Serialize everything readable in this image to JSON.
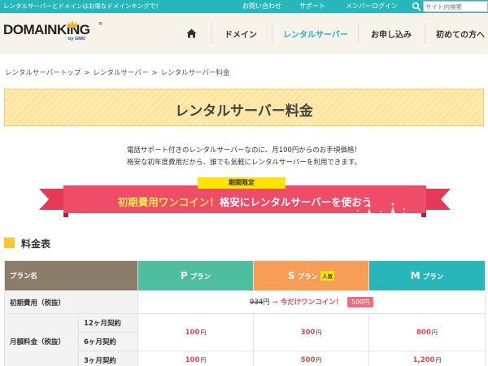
{
  "topbar": {
    "tagline": "レンタルサーバーとドメインはお得なドメインキングで！",
    "links": [
      "お問い合わせ",
      "サポート",
      "メンバーログイン"
    ],
    "search_placeholder": "サイト内検索"
  },
  "header": {
    "logo_main": "DOMAIN",
    "logo_accent": "KING",
    "logo_sub": "by GMO",
    "nav": [
      "ドメイン",
      "レンタルサーバー",
      "お申し込み",
      "初めての方へ"
    ],
    "active_nav": "レンタルサーバー"
  },
  "breadcrumb": [
    "レンタルサーバートップ",
    "レンタルサーバー",
    "レンタルサーバー料金"
  ],
  "page_title": "レンタルサーバー料金",
  "intro": [
    "電話サポート付きのレンタルサーバーなのに、月100円からのお手頃価格！",
    "格安な初年度費用だから、誰でも気軽にレンタルサーバーを利用できます。"
  ],
  "campaign": {
    "limited": "期間限定",
    "text_highlight": "初期費用ワンコイン！",
    "text_rest": "格安にレンタルサーバーを使おう"
  },
  "section_title": "料金表",
  "table": {
    "header_label": "プラン名",
    "plans": [
      {
        "letter": "P",
        "suffix": "プラン",
        "badge": ""
      },
      {
        "letter": "S",
        "suffix": "プラン",
        "badge": "人気"
      },
      {
        "letter": "M",
        "suffix": "プラン",
        "badge": ""
      }
    ],
    "initial_fee": {
      "label": "初期費用（税抜）",
      "original": "934",
      "original_unit": "円",
      "arrow": "→",
      "promo": "今だけワンコイン！",
      "badge": "500円"
    },
    "monthly": {
      "label": "月額料金（税抜）",
      "rows": [
        {
          "term": "12ヶ月契約",
          "prices": [
            "100",
            "300",
            "800"
          ]
        },
        {
          "term": "6ヶ月契約",
          "prices": [
            "",
            "",
            ""
          ]
        },
        {
          "term": "3ヶ月契約",
          "prices": [
            "100",
            "500",
            "1,200"
          ]
        }
      ],
      "unit": "円"
    }
  },
  "colors": {
    "teal": "#27b7ba",
    "header_bg": "#f7f3ea",
    "title_yellow": "#fde49a",
    "ribbon_red": "#ef4c6a",
    "plan_p": "#4fbe9f",
    "plan_s": "#f89d55",
    "plan_m": "#27b7ba",
    "price_red": "#e5484d"
  }
}
